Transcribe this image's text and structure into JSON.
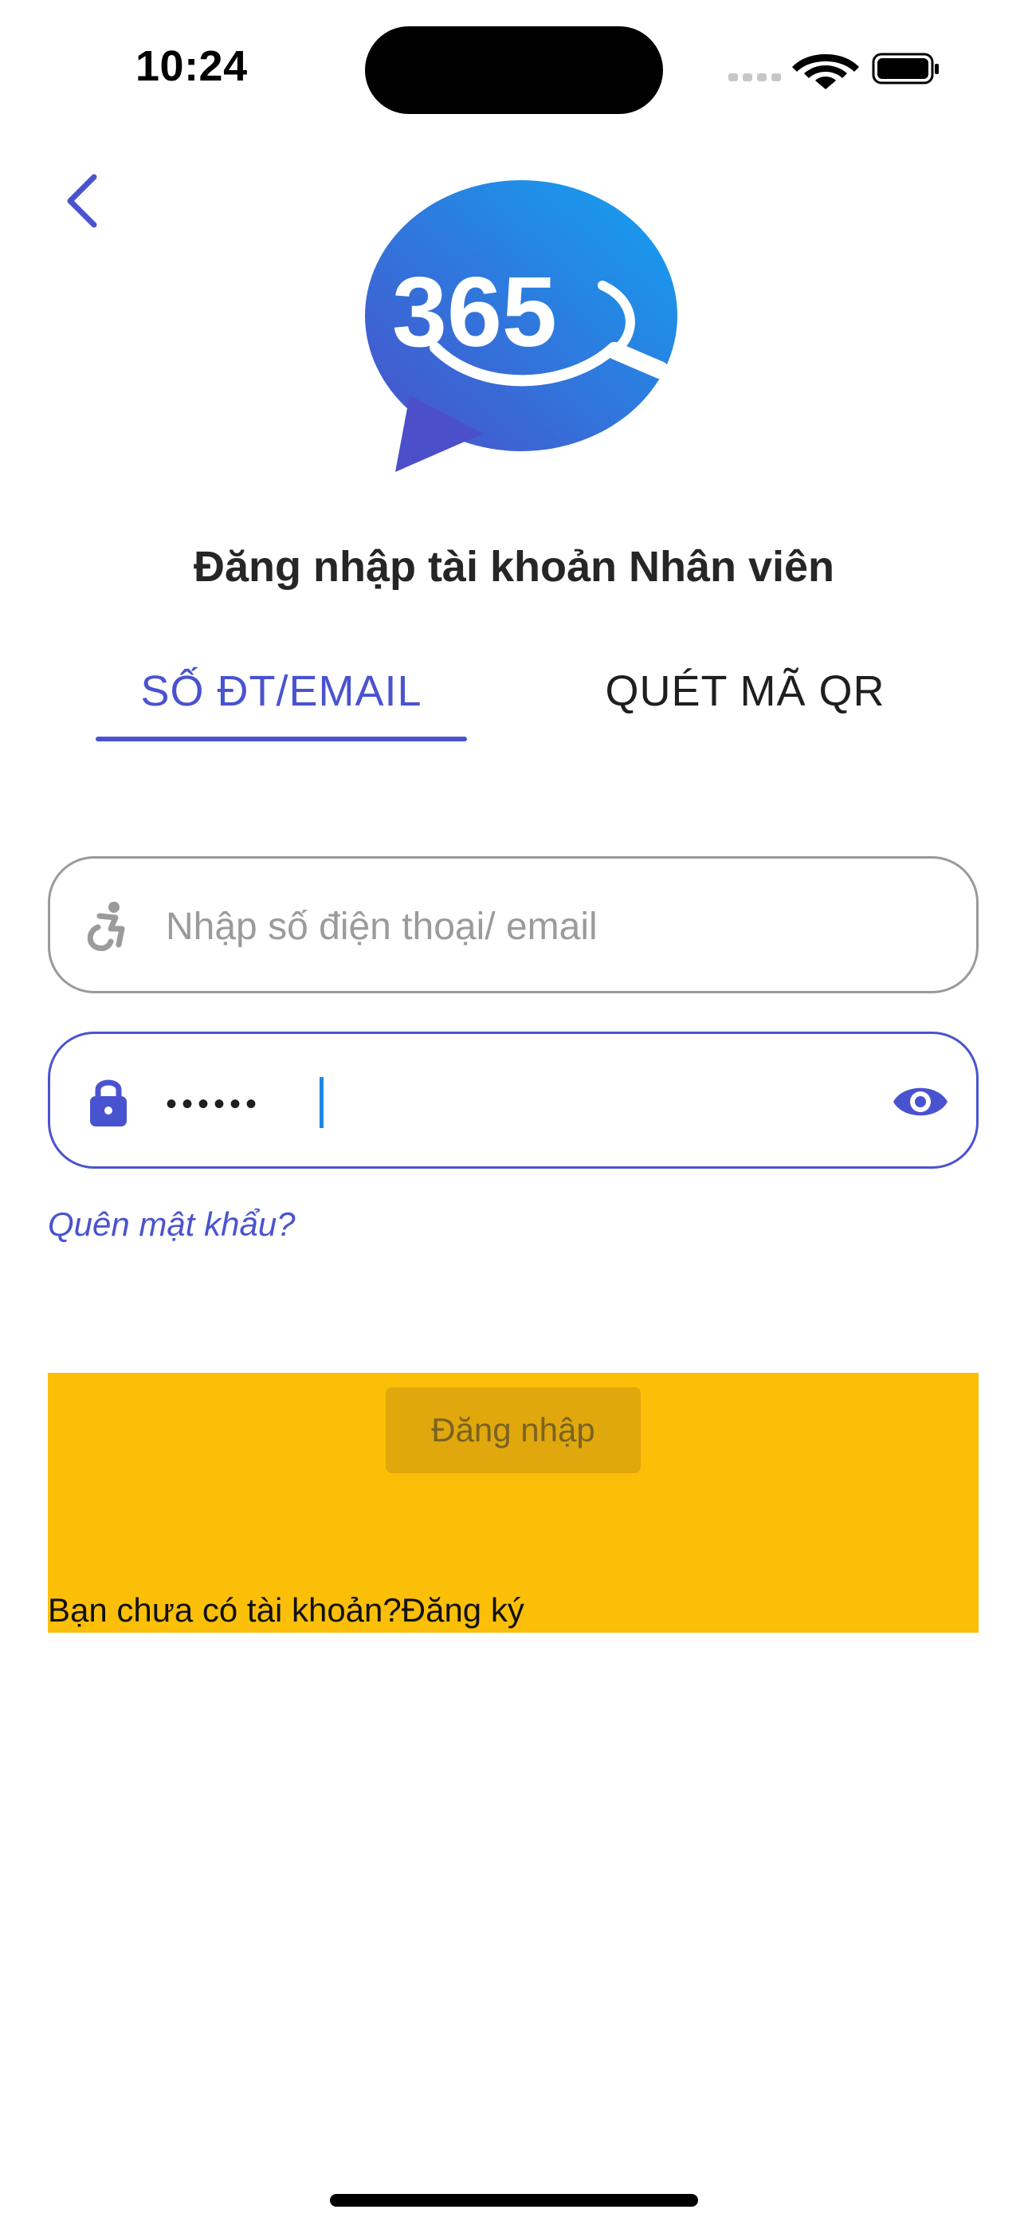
{
  "status_bar": {
    "time": "10:24"
  },
  "header": {
    "title": "Đăng nhập tài khoản Nhân viên"
  },
  "logo": {
    "text": "365",
    "colors": [
      "#16a0f0",
      "#4b4fc9"
    ]
  },
  "tabs": [
    {
      "label": "SỐ ĐT/EMAIL",
      "active": true
    },
    {
      "label": "QUÉT MÃ QR",
      "active": false
    }
  ],
  "form": {
    "phone_placeholder": "Nhập số điện thoại/ email",
    "phone_value": "",
    "password_masked": "••••••",
    "forgot_label": "Quên mật khẩu?",
    "login_label": "Đăng nhập",
    "no_account_text": "Bạn chưa có tài khoản?",
    "register_label": "Đăng ký"
  },
  "colors": {
    "accent": "#4a53cf",
    "yellow": "#fbbf07",
    "login_button_bg": "#e0a80c"
  }
}
